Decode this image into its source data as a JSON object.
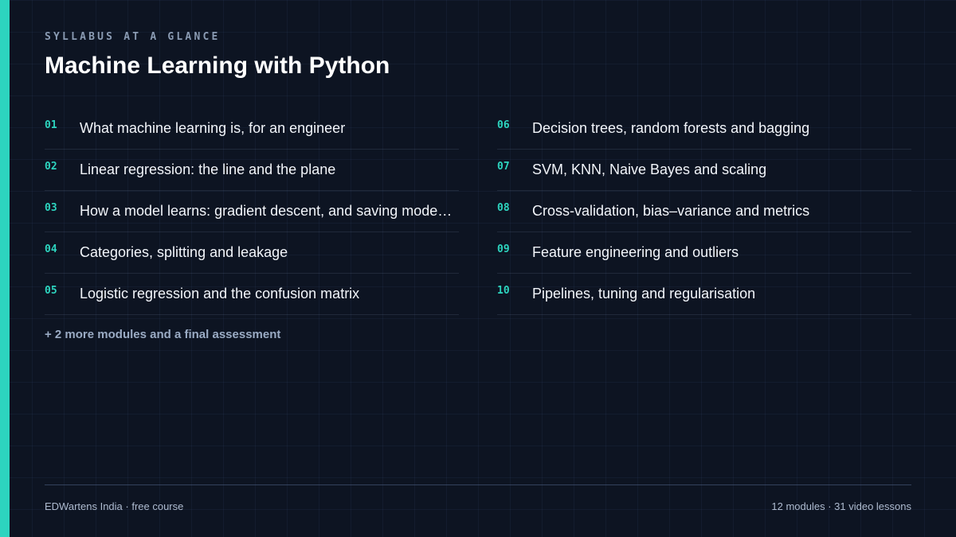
{
  "header": {
    "eyebrow": "SYLLABUS AT A GLANCE",
    "title": "Machine Learning with Python"
  },
  "modules_left": [
    {
      "number": "01",
      "title": "What machine learning is, for an engineer"
    },
    {
      "number": "02",
      "title": "Linear regression: the line and the plane"
    },
    {
      "number": "03",
      "title": "How a model learns: gradient descent, and saving mode…"
    },
    {
      "number": "04",
      "title": "Categories, splitting and leakage"
    },
    {
      "number": "05",
      "title": "Logistic regression and the confusion matrix"
    }
  ],
  "modules_right": [
    {
      "number": "06",
      "title": "Decision trees, random forests and bagging"
    },
    {
      "number": "07",
      "title": "SVM, KNN, Naive Bayes and scaling"
    },
    {
      "number": "08",
      "title": "Cross-validation, bias–variance and metrics"
    },
    {
      "number": "09",
      "title": "Feature engineering and outliers"
    },
    {
      "number": "10",
      "title": "Pipelines, tuning and regularisation"
    }
  ],
  "more_note": "+ 2 more modules and a final assessment",
  "footer": {
    "left": "EDWartens India · free course",
    "right": "12 modules · 31 video lessons"
  },
  "colors": {
    "accent": "#2dd4bf",
    "background": "#0d1422"
  }
}
